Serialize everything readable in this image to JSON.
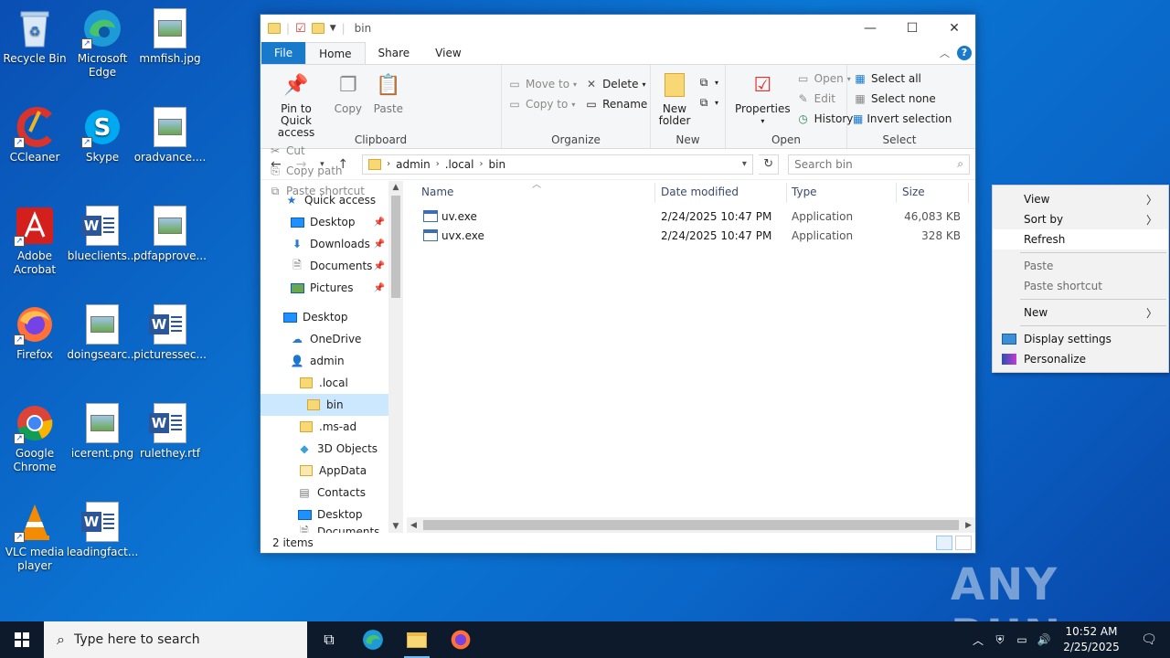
{
  "desktop": {
    "icons": [
      {
        "label": "Recycle Bin"
      },
      {
        "label": "Microsoft Edge"
      },
      {
        "label": "mmfish.jpg"
      },
      {
        "label": "CCleaner"
      },
      {
        "label": "Skype"
      },
      {
        "label": "oradvance...."
      },
      {
        "label": "Adobe Acrobat"
      },
      {
        "label": "blueclients..."
      },
      {
        "label": "pdfapprove..."
      },
      {
        "label": "Firefox"
      },
      {
        "label": "doingsearc..."
      },
      {
        "label": "picturessec..."
      },
      {
        "label": "Google Chrome"
      },
      {
        "label": "icerent.png"
      },
      {
        "label": "rulethey.rtf"
      },
      {
        "label": "VLC media player"
      },
      {
        "label": "leadingfact..."
      }
    ]
  },
  "explorer": {
    "title": "bin",
    "tabs": {
      "file": "File",
      "home": "Home",
      "share": "Share",
      "view": "View"
    },
    "ribbon": {
      "clipboard": {
        "name": "Clipboard",
        "pin": "Pin to Quick access",
        "copy": "Copy",
        "paste": "Paste",
        "cut": "Cut",
        "copy_path": "Copy path",
        "paste_shortcut": "Paste shortcut"
      },
      "organize": {
        "name": "Organize",
        "move_to": "Move to",
        "copy_to": "Copy to",
        "delete": "Delete",
        "rename": "Rename"
      },
      "new": {
        "name": "New",
        "new_folder": "New folder"
      },
      "open": {
        "name": "Open",
        "properties": "Properties",
        "open": "Open",
        "edit": "Edit",
        "history": "History"
      },
      "select": {
        "name": "Select",
        "select_all": "Select all",
        "select_none": "Select none",
        "invert": "Invert selection"
      }
    },
    "address": {
      "segments": [
        "admin",
        ".local",
        "bin"
      ]
    },
    "search_placeholder": "Search bin",
    "nav": {
      "quick_access": "Quick access",
      "qa_items": [
        "Desktop",
        "Downloads",
        "Documents",
        "Pictures"
      ],
      "desktop": "Desktop",
      "onedrive": "OneDrive",
      "admin": "admin",
      "local": ".local",
      "bin": "bin",
      "ms_ad": ".ms-ad",
      "objects": "3D Objects",
      "appdata": "AppData",
      "contacts": "Contacts",
      "desktop2": "Desktop",
      "documents_cut": "Documents"
    },
    "columns": {
      "name": "Name",
      "date": "Date modified",
      "type": "Type",
      "size": "Size"
    },
    "files": [
      {
        "name": "uv.exe",
        "date": "2/24/2025 10:47 PM",
        "type": "Application",
        "size": "46,083 KB"
      },
      {
        "name": "uvx.exe",
        "date": "2/24/2025 10:47 PM",
        "type": "Application",
        "size": "328 KB"
      }
    ],
    "status": "2 items"
  },
  "context_menu": {
    "view": "View",
    "sort_by": "Sort by",
    "refresh": "Refresh",
    "paste": "Paste",
    "paste_shortcut": "Paste shortcut",
    "new": "New",
    "display_settings": "Display settings",
    "personalize": "Personalize"
  },
  "watermark": "ANY RUN",
  "taskbar": {
    "search_placeholder": "Type here to search",
    "time": "10:52 AM",
    "date": "2/25/2025"
  },
  "colors": {
    "accent": "#1979ca",
    "selection": "#cce8ff",
    "taskbar": "#0c1a2b"
  }
}
